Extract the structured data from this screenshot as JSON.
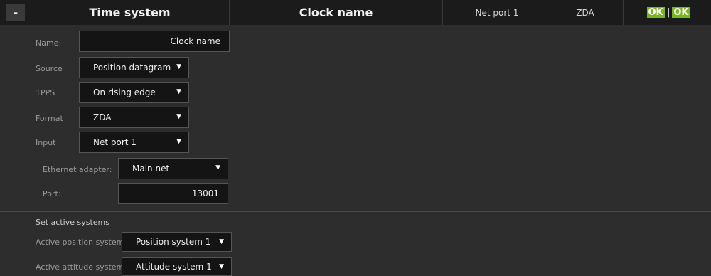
{
  "header": {
    "collapse_label": "-",
    "title": "Time system",
    "clock_name": "Clock name",
    "input": "Net port 1",
    "format": "ZDA",
    "status_1": "OK",
    "status_sep": "|",
    "status_2": "OK"
  },
  "form": {
    "name_label": "Name:",
    "name_value": "Clock name",
    "source_label": "Source",
    "source_value": "Position datagram",
    "pps_label": "1PPS",
    "pps_value": "On rising edge",
    "format_label": "Format",
    "format_value": "ZDA",
    "input_label": "Input",
    "input_value": "Net port 1",
    "ethernet_label": "Ethernet adapter:",
    "ethernet_value": "Main net",
    "port_label": "Port:",
    "port_value": "13001"
  },
  "active": {
    "title": "Set active systems",
    "position_label": "Active position system",
    "position_value": "Position system 1",
    "attitude_label": "Active attitude system",
    "attitude_value": "Attitude system 1"
  },
  "colors": {
    "ok_green": "#7ab51d",
    "header_bg": "#1b1b1b",
    "panel_bg": "#2d2d2d",
    "field_bg": "#141414"
  },
  "icons": {
    "caret": "caret-down-icon"
  }
}
